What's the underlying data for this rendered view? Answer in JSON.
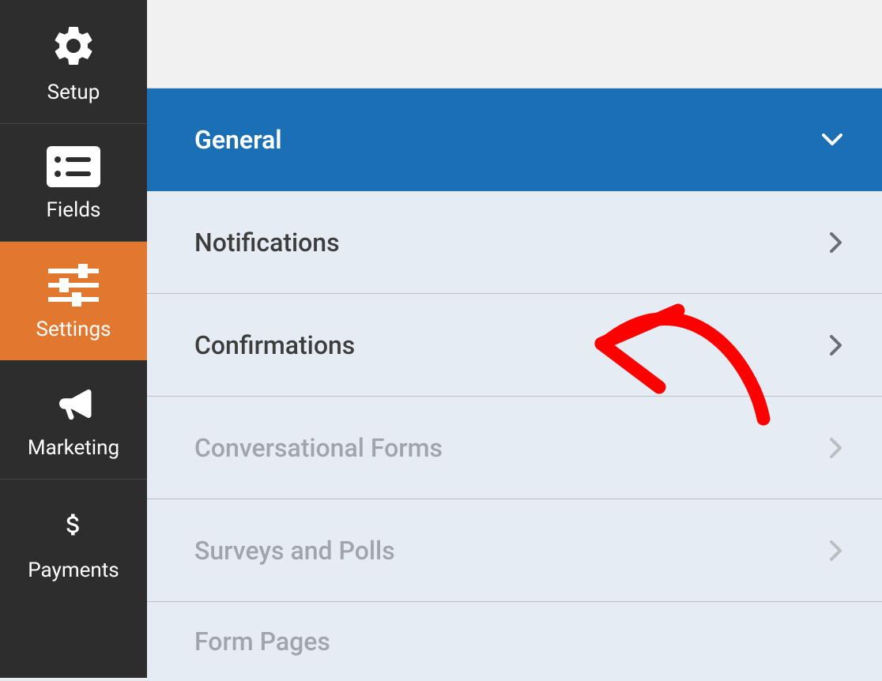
{
  "sidebar": {
    "items": [
      {
        "label": "Setup",
        "icon": "gear-icon",
        "active": false
      },
      {
        "label": "Fields",
        "icon": "list-icon",
        "active": false
      },
      {
        "label": "Settings",
        "icon": "sliders-icon",
        "active": true
      },
      {
        "label": "Marketing",
        "icon": "megaphone-icon",
        "active": false
      },
      {
        "label": "Payments",
        "icon": "dollar-icon",
        "active": false
      }
    ]
  },
  "settings_panel": {
    "items": [
      {
        "label": "General",
        "selected": true,
        "disabled": false
      },
      {
        "label": "Notifications",
        "selected": false,
        "disabled": false
      },
      {
        "label": "Confirmations",
        "selected": false,
        "disabled": false
      },
      {
        "label": "Conversational Forms",
        "selected": false,
        "disabled": true
      },
      {
        "label": "Surveys and Polls",
        "selected": false,
        "disabled": true
      },
      {
        "label": "Form Pages",
        "selected": false,
        "disabled": true
      }
    ]
  },
  "annotation": {
    "type": "hand-drawn-arrow",
    "color": "#ff0000",
    "points_to": "Confirmations"
  }
}
